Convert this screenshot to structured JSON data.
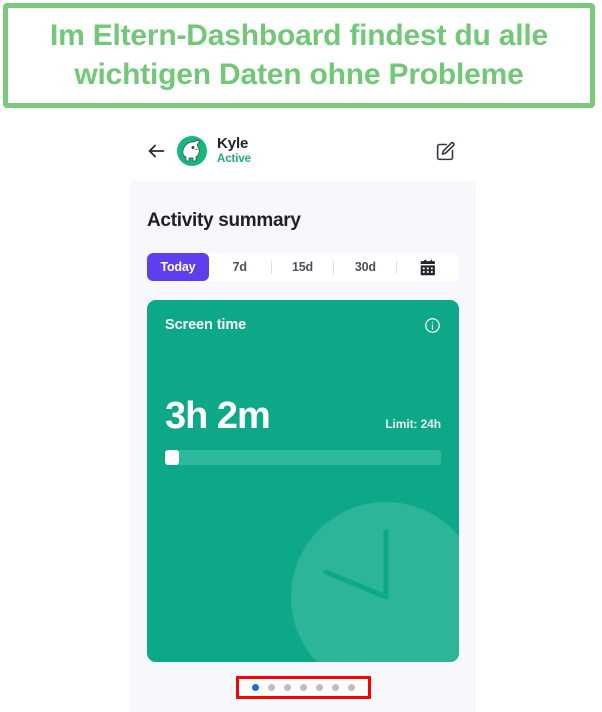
{
  "banner": {
    "text": "Im Eltern-Dashboard findest du alle wichtigen Daten ohne Probleme",
    "text_color": "#73c878",
    "border_color": "#7cc97e"
  },
  "app_header": {
    "back_icon": "arrow-left-icon",
    "avatar_alt": "kyle-avatar",
    "profile_name": "Kyle",
    "profile_status": "Active",
    "status_color": "#23a888",
    "edit_icon": "edit-pencil-square-icon"
  },
  "main": {
    "section_title": "Activity summary",
    "segmented": {
      "active_color": "#5d3fee",
      "items": [
        {
          "label": "Today",
          "active": true
        },
        {
          "label": "7d",
          "active": false
        },
        {
          "label": "15d",
          "active": false
        },
        {
          "label": "30d",
          "active": false
        }
      ],
      "calendar_icon": "calendar-icon"
    },
    "screen_time_card": {
      "title": "Screen time",
      "info_icon": "info-circle-icon",
      "value": "3h 2m",
      "limit_label": "Limit: 24h",
      "progress_percent": 5,
      "background_color": "#0ca888",
      "decor_icon": "clock-icon"
    },
    "carousel": {
      "total_dots": 7,
      "active_index": 0,
      "active_color": "#0f6ef0",
      "inactive_color": "#b9bdc6",
      "highlight_color": "#ff0000"
    }
  }
}
